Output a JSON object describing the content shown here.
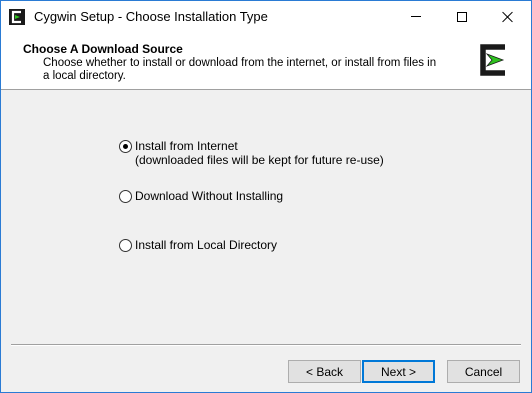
{
  "window": {
    "title": "Cygwin Setup - Choose Installation Type",
    "icon": "cygwin-icon",
    "controls": [
      "minimize-icon",
      "maximize-icon",
      "close-icon"
    ]
  },
  "header": {
    "title": "Choose A Download Source",
    "description": "Choose whether to install or download from the internet, or install from files in a local directory.",
    "logo": "cygwin-logo"
  },
  "options": [
    {
      "label": "Install from Internet",
      "sublabel": "(downloaded files will be kept for future re-use)",
      "selected": true
    },
    {
      "label": "Download Without Installing",
      "selected": false
    },
    {
      "label": "Install from Local Directory",
      "selected": false
    }
  ],
  "buttons": {
    "back": "< Back",
    "next": "Next >",
    "cancel": "Cancel"
  },
  "colors": {
    "accent": "#0078d7",
    "logo_green": "#2fc21f",
    "logo_black": "#1a1a1a"
  }
}
